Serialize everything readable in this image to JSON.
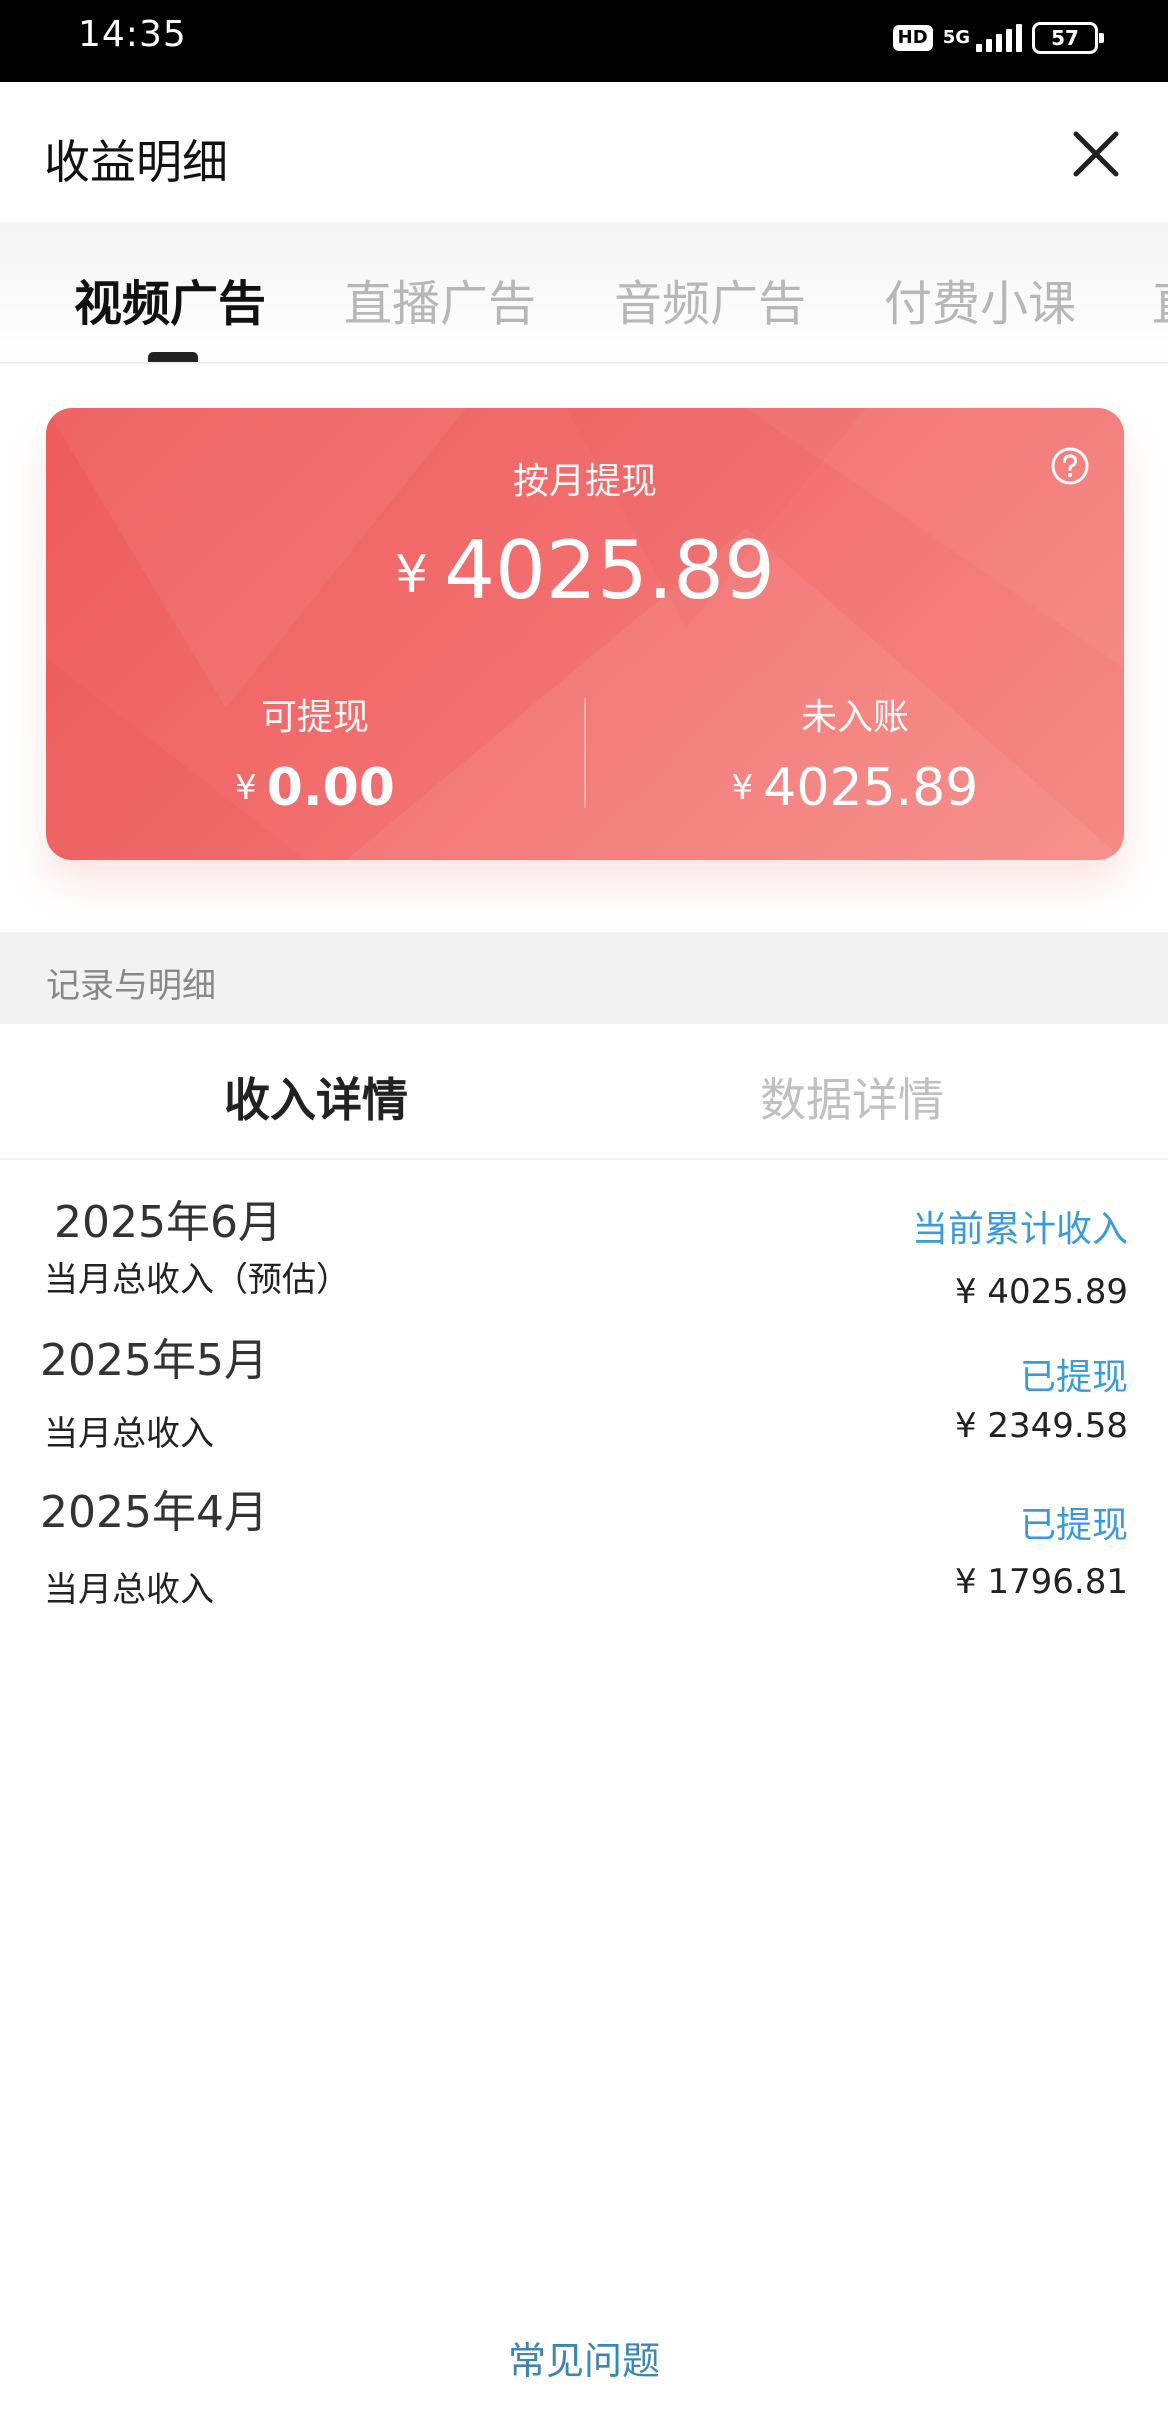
{
  "status_bar": {
    "time": "14:35",
    "hd": "HD",
    "network": "5G",
    "battery": "57"
  },
  "header": {
    "title": "收益明细",
    "close_icon": "close-icon"
  },
  "tabs": [
    {
      "label": "视频广告",
      "active": true
    },
    {
      "label": "直播广告",
      "active": false
    },
    {
      "label": "音频广告",
      "active": false
    },
    {
      "label": "付费小课",
      "active": false
    },
    {
      "label": "直",
      "active": false
    }
  ],
  "card": {
    "title": "按月提现",
    "currency": "¥",
    "total": "4025.89",
    "withdrawable_label": "可提现",
    "withdrawable_amount": "0.00",
    "pending_label": "未入账",
    "pending_amount": "4025.89",
    "help_icon": "question-circle-icon",
    "colors": {
      "start": "#ee5b5b",
      "end": "#f58a85"
    }
  },
  "records_section": {
    "label": "记录与明细"
  },
  "sub_tabs": [
    {
      "label": "收入详情",
      "active": true
    },
    {
      "label": "数据详情",
      "active": false
    }
  ],
  "records": [
    {
      "month": "2025年6月",
      "status": "当前累计收入",
      "desc": "当月总收入（预估）",
      "amount": "¥ 4025.89"
    },
    {
      "month": "2025年5月",
      "status": "已提现",
      "desc": "当月总收入",
      "amount": "¥ 2349.58"
    },
    {
      "month": "2025年4月",
      "status": "已提现",
      "desc": "当月总收入",
      "amount": "¥ 1796.81"
    }
  ],
  "footer": {
    "faq_label": "常见问题"
  },
  "accent_color": "#3a9bd8"
}
